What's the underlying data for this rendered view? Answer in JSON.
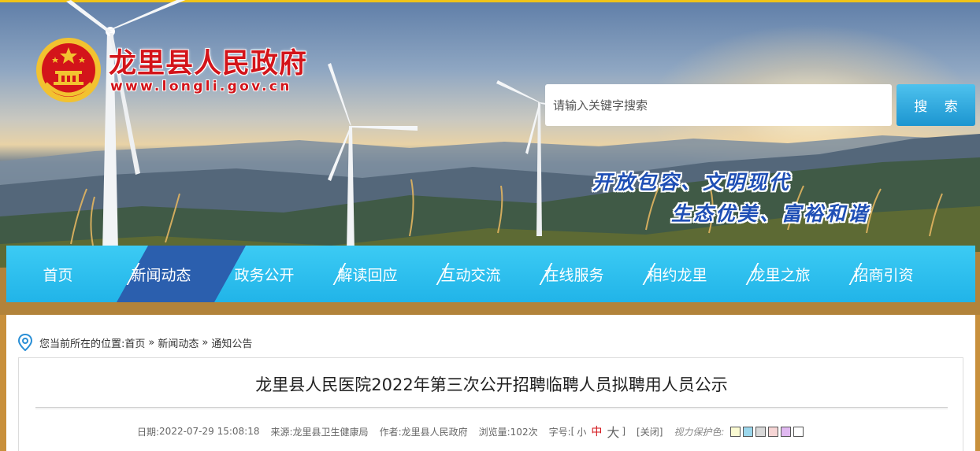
{
  "site": {
    "name": "龙里县人民政府",
    "url": "www.longli.gov.cn"
  },
  "search": {
    "placeholder": "请输入关键字搜索",
    "button_label": "搜 索"
  },
  "slogan": {
    "line1": "开放包容、文明现代",
    "line2": "生态优美、富裕和谐"
  },
  "nav": {
    "items": [
      {
        "label": "首页"
      },
      {
        "label": "新闻动态"
      },
      {
        "label": "政务公开"
      },
      {
        "label": "解读回应"
      },
      {
        "label": "互动交流"
      },
      {
        "label": "在线服务"
      },
      {
        "label": "相约龙里"
      },
      {
        "label": "龙里之旅"
      },
      {
        "label": "招商引资"
      }
    ],
    "active_index": 1
  },
  "breadcrumb": {
    "prefix": "您当前所在的位置:",
    "items": [
      "首页",
      "新闻动态",
      "通知公告"
    ],
    "separator": "»"
  },
  "article": {
    "title": "龙里县人民医院2022年第三次公开招聘临聘人员拟聘用人员公示",
    "meta": {
      "date_label": "日期:",
      "date": "2022-07-29 15:08:18",
      "source_label": "来源:",
      "source": "龙里县卫生健康局",
      "author_label": "作者:",
      "author": "龙里县人民政府",
      "views_label": "浏览量:",
      "views": "102次",
      "fontsize_label": "字号:",
      "bracket_open": "[",
      "bracket_close": "]",
      "font_small": "小",
      "font_mid": "中",
      "font_big": "大",
      "close_label": "[关闭]",
      "eye_label": "视力保护色:"
    },
    "eye_colors": [
      "#fafad2",
      "#9bd7ec",
      "#d9d9d9",
      "#f6d5d5",
      "#e0b8f0",
      "#ffffff"
    ]
  },
  "colors": {
    "brand_red": "#d3141a",
    "nav_bg": "#2fc0ef",
    "nav_active": "#2b5fae",
    "search_button": "#26a3dd",
    "slogan_blue": "#1f4fb5"
  }
}
